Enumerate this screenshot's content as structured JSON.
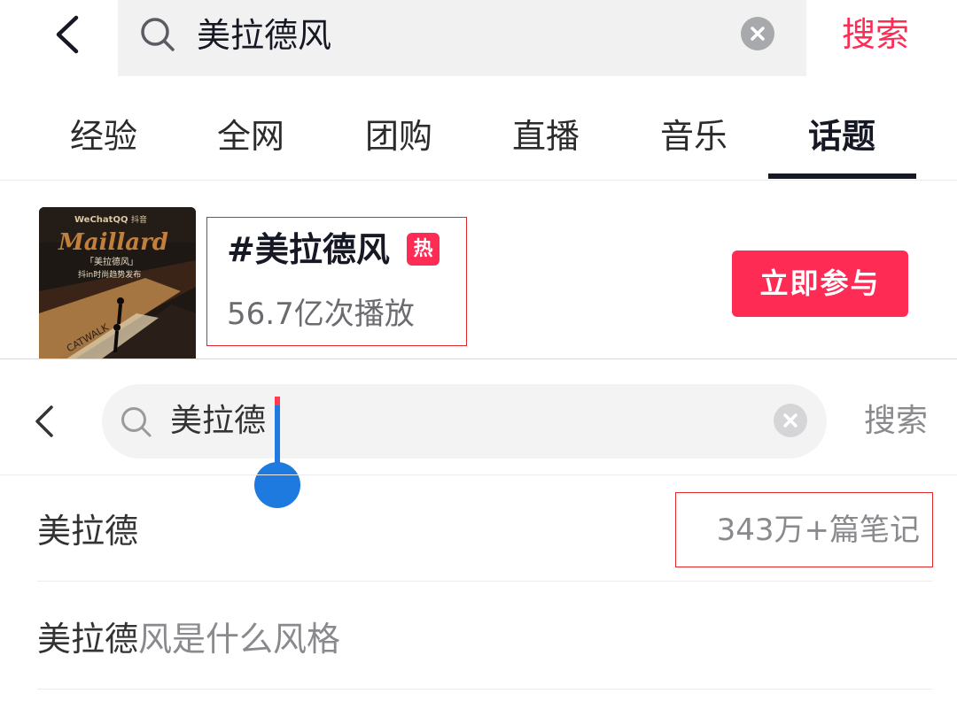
{
  "douyin": {
    "search": {
      "query": "美拉德风",
      "submit_label": "搜索"
    },
    "tabs": [
      {
        "label": "经验",
        "active": false
      },
      {
        "label": "全网",
        "active": false
      },
      {
        "label": "团购",
        "active": false
      },
      {
        "label": "直播",
        "active": false
      },
      {
        "label": "音乐",
        "active": false
      },
      {
        "label": "话题",
        "active": true
      }
    ],
    "topic": {
      "title": "#美拉德风",
      "badge": "热",
      "plays": "56.7亿次播放",
      "join_label": "立即参与",
      "thumbnail": {
        "brand": "WeChatQQ",
        "tiktok": "抖音",
        "script": "Maillard",
        "line1": "「美拉德风」",
        "line2": "抖in时尚趋势发布",
        "stripe": "CATWALK"
      }
    }
  },
  "xhs": {
    "search": {
      "query": "美拉德",
      "submit_label": "搜索"
    },
    "suggestions": [
      {
        "typed": "美拉德",
        "rest": "",
        "count": "343万+篇笔记"
      },
      {
        "typed": "美拉德",
        "rest": "风是什么风格",
        "count": ""
      }
    ]
  },
  "colors": {
    "accent": "#fe2c55",
    "highlight_box": "#e02828",
    "cursor": "#1f7ae0"
  }
}
